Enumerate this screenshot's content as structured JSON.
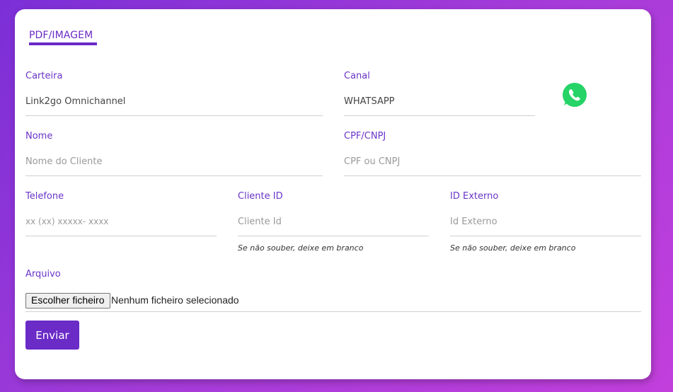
{
  "tab": {
    "label": "PDF/IMAGEM"
  },
  "fields": {
    "carteira": {
      "label": "Carteira",
      "value": "Link2go Omnichannel"
    },
    "canal": {
      "label": "Canal",
      "value": "WHATSAPP",
      "icon": "whatsapp-icon"
    },
    "nome": {
      "label": "Nome",
      "placeholder": "Nome do Cliente"
    },
    "cpf": {
      "label": "CPF/CNPJ",
      "placeholder": "CPF ou CNPJ"
    },
    "telefone": {
      "label": "Telefone",
      "placeholder": "xx (xx) xxxxx- xxxx"
    },
    "cliente_id": {
      "label": "Cliente ID",
      "placeholder": "Cliente Id",
      "hint": "Se não souber, deixe em branco"
    },
    "id_externo": {
      "label": "ID Externo",
      "placeholder": "Id Externo",
      "hint": "Se não souber, deixe em branco"
    },
    "arquivo": {
      "label": "Arquivo",
      "button_label": "Escolher ficheiro",
      "status": "Nenhum ficheiro selecionado"
    }
  },
  "submit": {
    "label": "Enviar"
  },
  "colors": {
    "accent": "#6a2bc7",
    "whatsapp": "#25d366"
  }
}
